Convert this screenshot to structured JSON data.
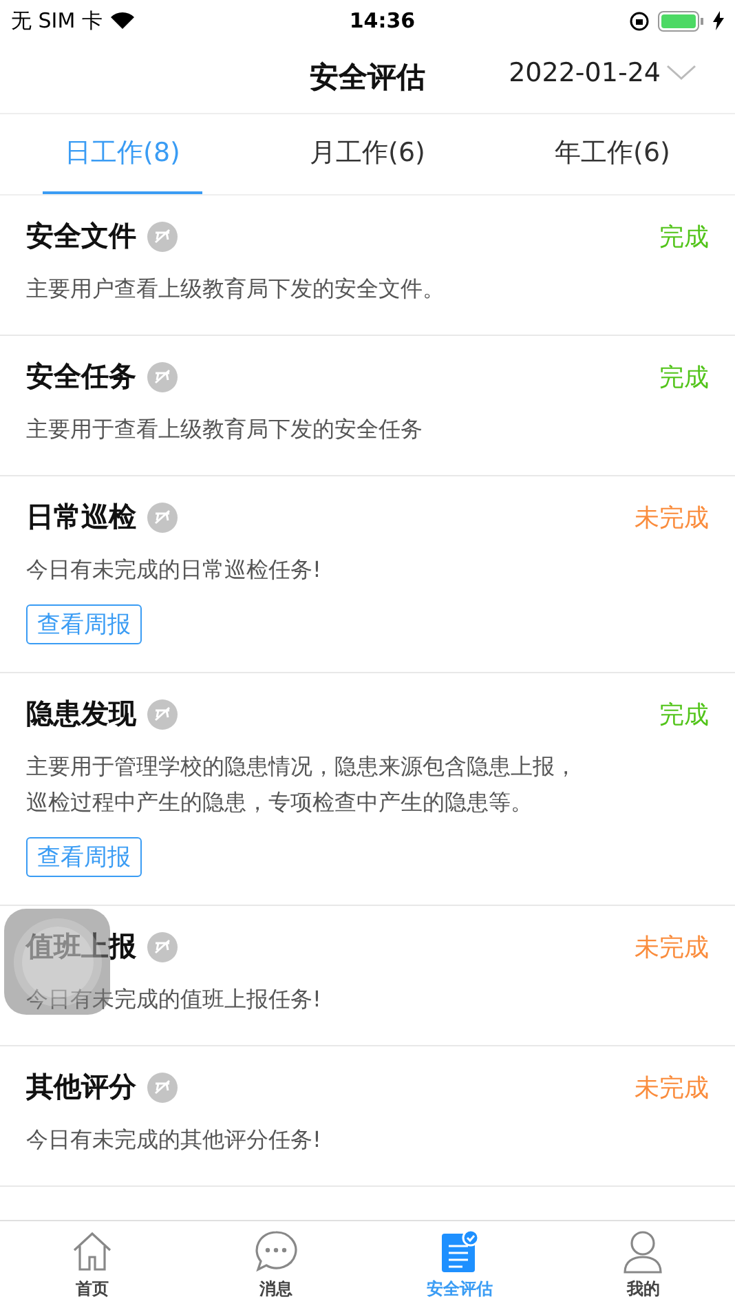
{
  "status_bar": {
    "carrier": "无 SIM 卡",
    "time": "14:36"
  },
  "header": {
    "title": "安全评估",
    "date": "2022-01-24"
  },
  "tabs": [
    {
      "label": "日工作(8)",
      "selected": true
    },
    {
      "label": "月工作(6)",
      "selected": false
    },
    {
      "label": "年工作(6)",
      "selected": false
    }
  ],
  "tasks": [
    {
      "title": "安全文件",
      "status": "完成",
      "complete": true,
      "description": "主要用户查看上级教育局下发的安全文件。"
    },
    {
      "title": "安全任务",
      "status": "完成",
      "complete": true,
      "description": "主要用于查看上级教育局下发的安全任务"
    },
    {
      "title": "日常巡检",
      "status": "未完成",
      "complete": false,
      "description": "今日有未完成的日常巡检任务!",
      "action": "查看周报"
    },
    {
      "title": "隐患发现",
      "status": "完成",
      "complete": true,
      "description": "主要用于管理学校的隐患情况，隐患来源包含隐患上报，巡检过程中产生的隐患，专项检查中产生的隐患等。",
      "action": "查看周报"
    },
    {
      "title": "值班上报",
      "status": "未完成",
      "complete": false,
      "description": "今日有未完成的值班上报任务!"
    },
    {
      "title": "其他评分",
      "status": "未完成",
      "complete": false,
      "description": "今日有未完成的其他评分任务!"
    }
  ],
  "bottom_nav": [
    {
      "label": "首页",
      "kind": "home",
      "selected": false
    },
    {
      "label": "消息",
      "kind": "chat",
      "selected": false
    },
    {
      "label": "安全评估",
      "kind": "document",
      "selected": true
    },
    {
      "label": "我的",
      "kind": "person",
      "selected": false
    }
  ]
}
